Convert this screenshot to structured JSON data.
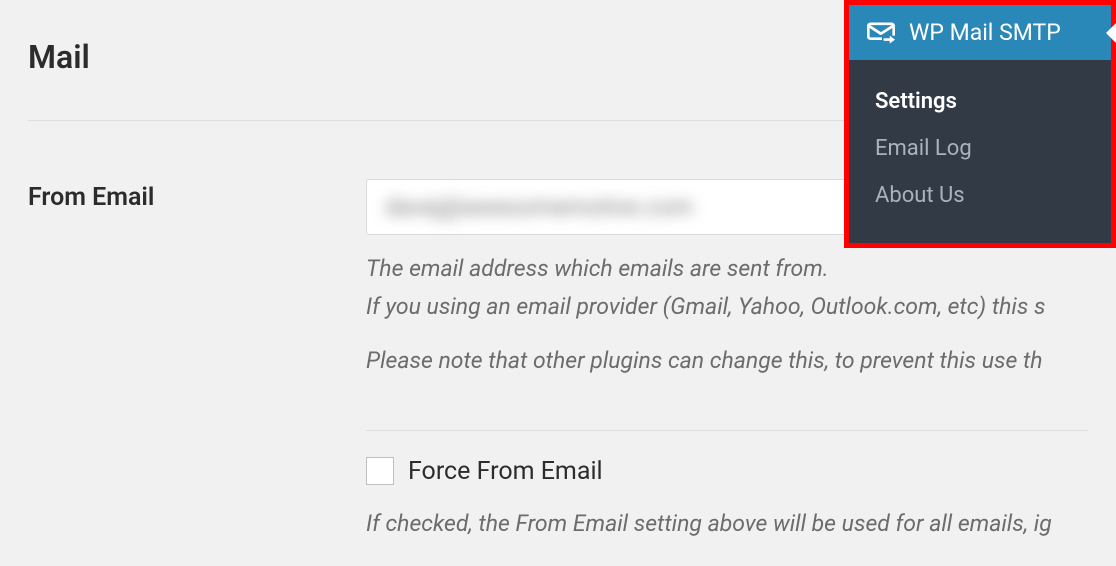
{
  "section": {
    "title": "Mail"
  },
  "from_email": {
    "label": "From Email",
    "value_blurred": "davej@awesomemotive.com",
    "desc_line1": "The email address which emails are sent from.",
    "desc_line2": "If you using an email provider (Gmail, Yahoo, Outlook.com, etc) this s",
    "desc_note": "Please note that other plugins can change this, to prevent this use th"
  },
  "force_from_email": {
    "label": "Force From Email",
    "checked": false,
    "desc": "If checked, the From Email setting above will be used for all emails, ig"
  },
  "flyout": {
    "title": "WP Mail SMTP",
    "items": [
      {
        "label": "Settings",
        "active": true
      },
      {
        "label": "Email Log",
        "active": false
      },
      {
        "label": "About Us",
        "active": false
      }
    ]
  }
}
